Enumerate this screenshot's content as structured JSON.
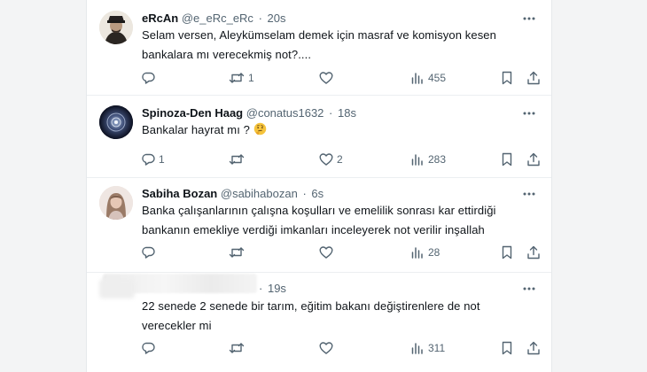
{
  "tweets": [
    {
      "name": "eRcAn",
      "handle": "@e_eRc_eRc",
      "dot": "·",
      "time": "20s",
      "text": "Selam versen, Aleykümselam demek için masraf ve komisyon kesen bankalara mı verecekmiş not?....",
      "replies": "",
      "retweets": "1",
      "likes": "",
      "views": "455"
    },
    {
      "name": "Spinoza-Den Haag",
      "handle": "@conatus1632",
      "dot": "·",
      "time": "18s",
      "text": "Bankalar hayrat mı ?",
      "emoji": "thinking-face-emoji",
      "replies": "1",
      "retweets": "",
      "likes": "2",
      "views": "283"
    },
    {
      "name": "Sabiha Bozan",
      "handle": "@sabihabozan",
      "dot": "·",
      "time": "6s",
      "text": "Banka çalışanlarının çalışna koşulları ve emelilik sonrası kar ettirdiği bankanın emekliye verdiği imkanları inceleyerek not verilir inşallah",
      "replies": "",
      "retweets": "",
      "likes": "",
      "views": "28"
    },
    {
      "dot": "·",
      "time": "19s",
      "text": "22 senede 2 senede bir tarım, eğitim bakanı değiştirenlere de not verecekler mi",
      "replies": "",
      "retweets": "",
      "likes": "",
      "views": "311"
    }
  ],
  "icons": {
    "reply": "reply-icon",
    "retweet": "retweet-icon",
    "like": "heart-icon",
    "views": "views-chart-icon",
    "bookmark": "bookmark-icon",
    "share": "share-icon",
    "more": "more-options-icon"
  },
  "colors": {
    "text": "#0f1419",
    "secondary": "#536471",
    "icon": "#536471",
    "background": "#ffffff"
  }
}
